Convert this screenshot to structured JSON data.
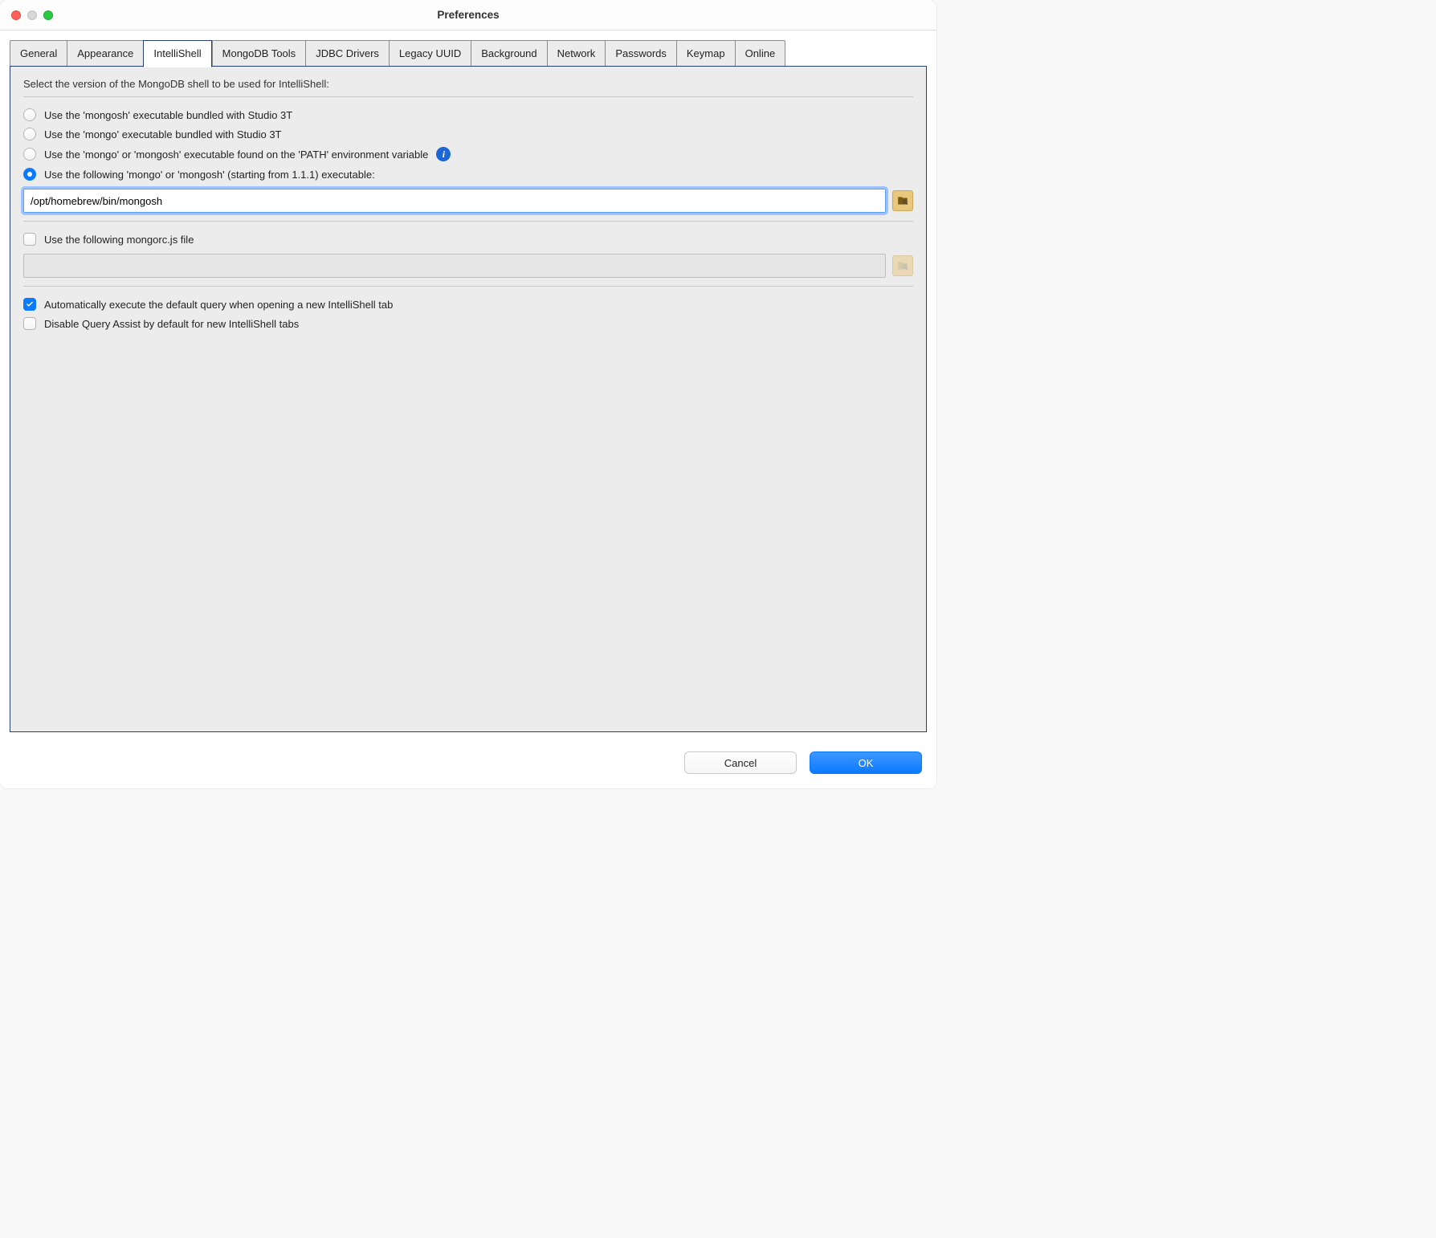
{
  "window": {
    "title": "Preferences"
  },
  "tabs": [
    {
      "label": "General"
    },
    {
      "label": "Appearance"
    },
    {
      "label": "IntelliShell",
      "active": true
    },
    {
      "label": "MongoDB Tools"
    },
    {
      "label": "JDBC Drivers"
    },
    {
      "label": "Legacy UUID"
    },
    {
      "label": "Background"
    },
    {
      "label": "Network"
    },
    {
      "label": "Passwords"
    },
    {
      "label": "Keymap"
    },
    {
      "label": "Online"
    }
  ],
  "panel": {
    "section_label": "Select the version of the MongoDB shell to be used for IntelliShell:",
    "shell_options": [
      {
        "label": "Use the 'mongosh' executable bundled with Studio 3T",
        "selected": false
      },
      {
        "label": "Use the 'mongo' executable bundled with Studio 3T",
        "selected": false
      },
      {
        "label": "Use the 'mongo' or 'mongosh' executable found on the 'PATH' environment variable",
        "selected": false,
        "info": true
      },
      {
        "label": "Use the following 'mongo' or 'mongosh' (starting from 1.1.1) executable:",
        "selected": true
      }
    ],
    "executable_path": "/opt/homebrew/bin/mongosh",
    "mongorc": {
      "checkbox_label": "Use the following mongorc.js file",
      "checked": false,
      "path": ""
    },
    "auto_exec": {
      "label": "Automatically execute the default query when opening a new IntelliShell tab",
      "checked": true
    },
    "disable_assist": {
      "label": "Disable Query Assist by default for new IntelliShell tabs",
      "checked": false
    }
  },
  "footer": {
    "cancel": "Cancel",
    "ok": "OK"
  }
}
